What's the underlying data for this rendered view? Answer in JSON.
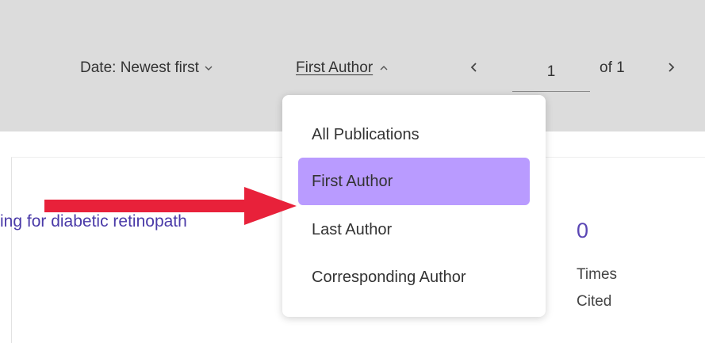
{
  "toolbar": {
    "sort_label": "Date: Newest first",
    "filter_label": "First Author",
    "pager": {
      "current_page": "1",
      "of_label": "of 1"
    }
  },
  "dropdown": {
    "items": [
      {
        "label": "All Publications",
        "selected": false
      },
      {
        "label": "First Author",
        "selected": true
      },
      {
        "label": "Last Author",
        "selected": false
      },
      {
        "label": "Corresponding Author",
        "selected": false
      }
    ]
  },
  "result": {
    "title_fragment": "ing for diabetic retinopath",
    "times_cited_count": "0",
    "times_cited_label": "Times Cited"
  },
  "colors": {
    "toolbar_bg": "#dcdcdc",
    "selected_item_bg": "#b99bff",
    "link_color": "#4a3aa8",
    "annotation_arrow": "#e8213a"
  },
  "icons": {
    "sort_chevron": "chevron-down-icon",
    "filter_chevron": "chevron-up-icon",
    "prev": "chevron-left-icon",
    "next": "chevron-right-icon",
    "annotation": "arrow-right-icon"
  }
}
